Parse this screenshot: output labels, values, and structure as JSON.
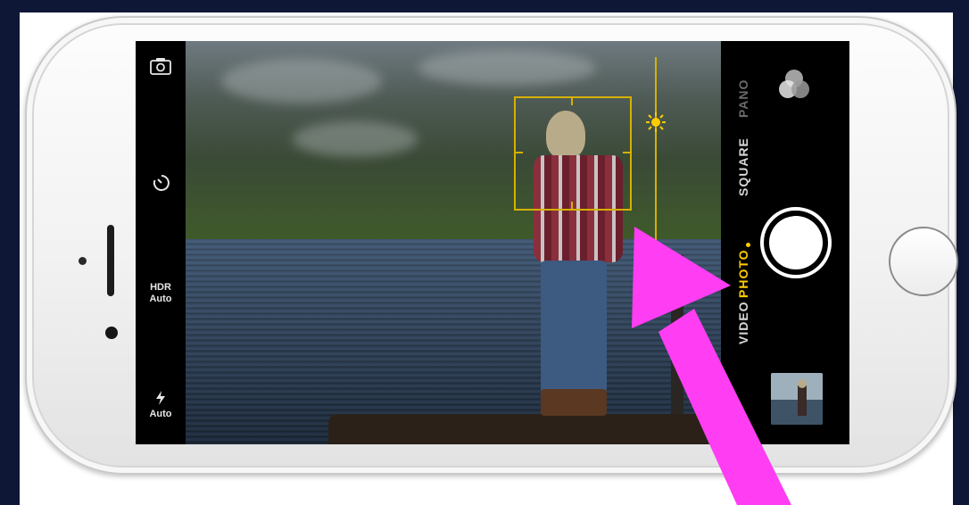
{
  "camera": {
    "left_toolbar": {
      "camera_switch_icon": "camera-flip-icon",
      "timer_icon": "timer-icon",
      "hdr_label": "HDR",
      "hdr_value": "Auto",
      "flash_icon": "flash-icon",
      "flash_value": "Auto"
    },
    "modes": [
      "VIDEO",
      "PHOTO",
      "SQUARE",
      "PANO"
    ],
    "selected_mode": "PHOTO",
    "accent_color": "#ffcc00",
    "focus_color": "#d6b100",
    "annotation_arrow_color": "#ff3df2"
  }
}
